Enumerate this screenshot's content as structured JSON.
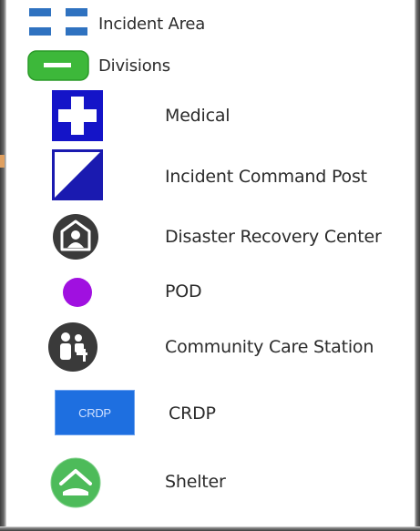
{
  "legend": {
    "items": [
      {
        "label": "Incident Area",
        "symbol": "dashed-blue-area"
      },
      {
        "label": "Divisions",
        "symbol": "green-division-bar"
      },
      {
        "label": "Medical",
        "symbol": "medical-cross-icon"
      },
      {
        "label": "Incident Command Post",
        "symbol": "command-post-flag-icon"
      },
      {
        "label": "Disaster Recovery Center",
        "symbol": "recovery-center-icon"
      },
      {
        "label": "POD",
        "symbol": "pod-dot-icon"
      },
      {
        "label": "Community Care Station",
        "symbol": "care-station-icon"
      },
      {
        "label": "CRDP",
        "symbol": "crdp-box-icon",
        "symbol_text": "CRDP"
      },
      {
        "label": "Shelter",
        "symbol": "shelter-icon"
      }
    ]
  },
  "colors": {
    "incident_blue": "#2f72c0",
    "division_green": "#3db83a",
    "medical_blue": "#1414c8",
    "icp_blue": "#1a1ab0",
    "dark_icon": "#3a3a3a",
    "pod_purple": "#a010e0",
    "crdp_blue": "#1e6fe0",
    "shelter_green": "#4dbb5a"
  }
}
